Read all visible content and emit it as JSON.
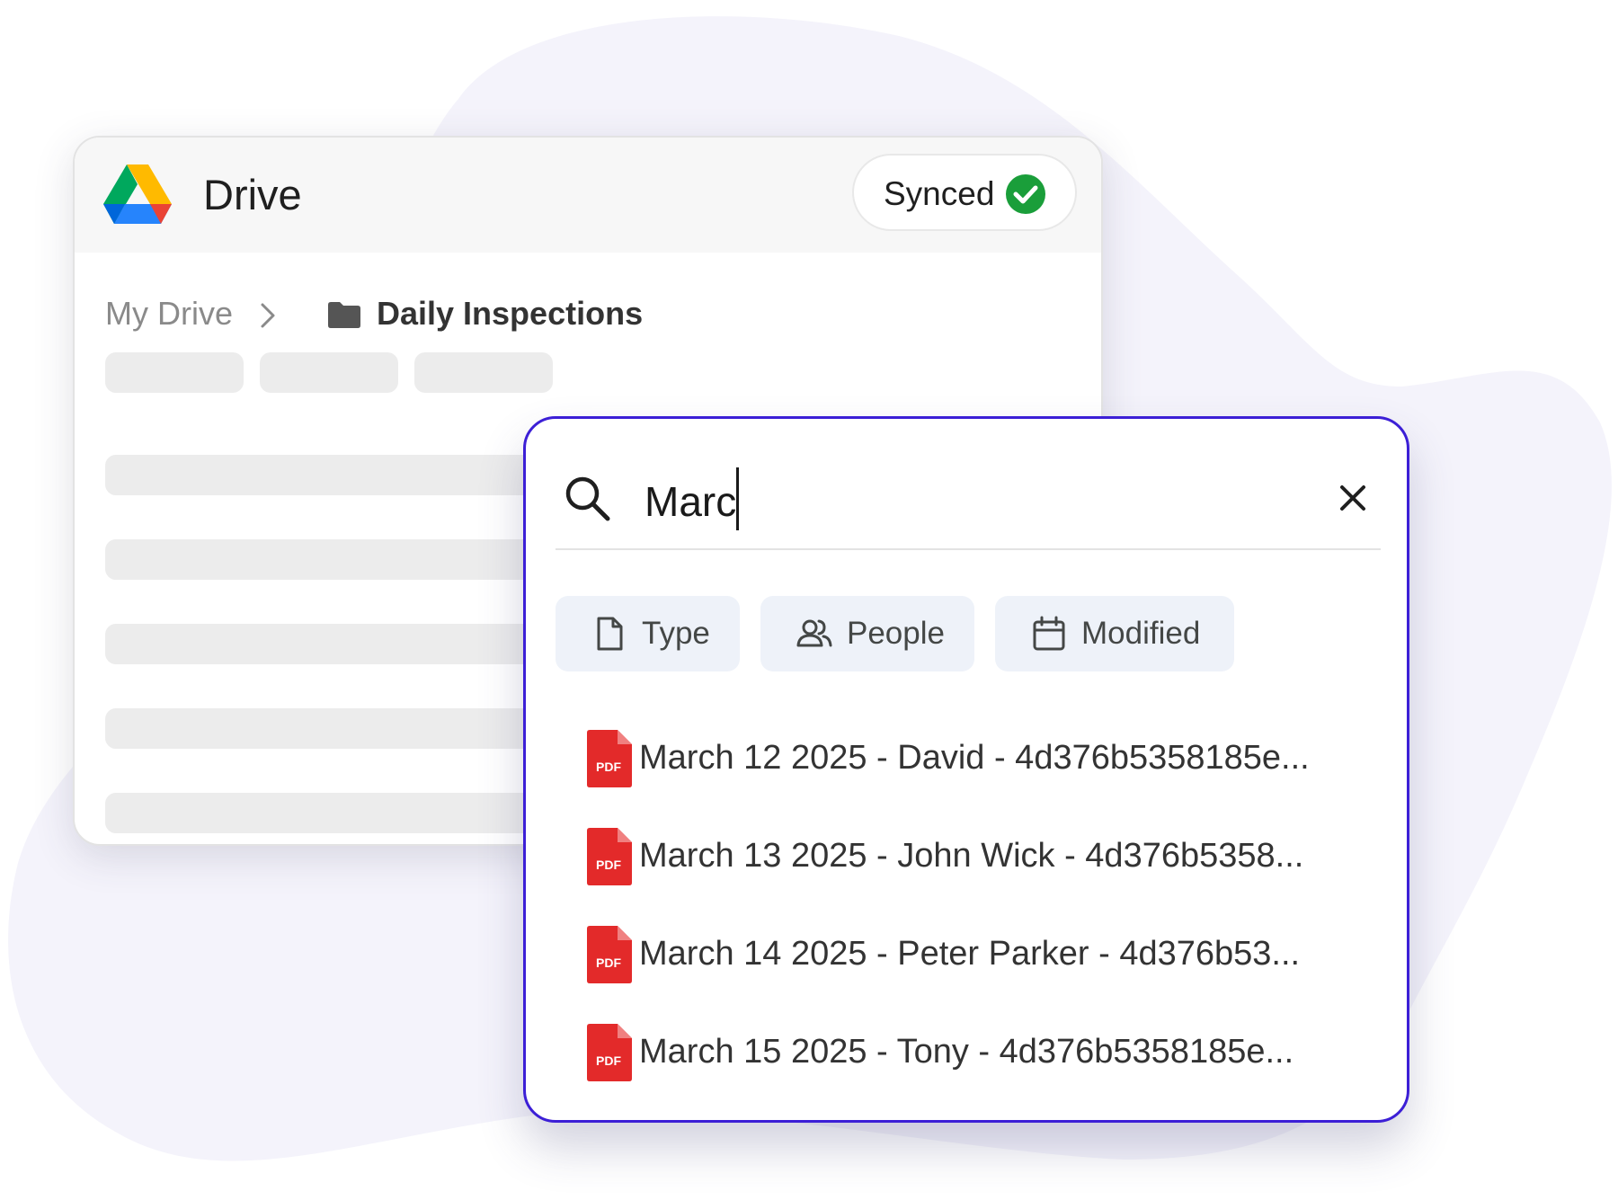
{
  "app": {
    "title": "Drive",
    "sync_status": "Synced"
  },
  "breadcrumb": {
    "root": "My Drive",
    "current": "Daily Inspections"
  },
  "search": {
    "query": "Marc",
    "filters": [
      {
        "label": "Type",
        "icon": "file-icon"
      },
      {
        "label": "People",
        "icon": "people-icon"
      },
      {
        "label": "Modified",
        "icon": "calendar-icon"
      }
    ],
    "results": [
      {
        "name": "March 12 2025 - David -  4d376b5358185e...",
        "icon": "pdf-icon",
        "badge": "PDF"
      },
      {
        "name": "March 13 2025 - John Wick -  4d376b5358...",
        "icon": "pdf-icon",
        "badge": "PDF"
      },
      {
        "name": "March 14 2025 - Peter Parker -  4d376b53...",
        "icon": "pdf-icon",
        "badge": "PDF"
      },
      {
        "name": "March 15 2025 - Tony -  4d376b5358185e...",
        "icon": "pdf-icon",
        "badge": "PDF"
      }
    ]
  },
  "colors": {
    "panel_border": "#3c1fd6",
    "synced_check": "#1a9e3a",
    "pdf_red": "#e32a2a",
    "chip_background": "#eef2f9",
    "blob": "#f4f3fb"
  }
}
